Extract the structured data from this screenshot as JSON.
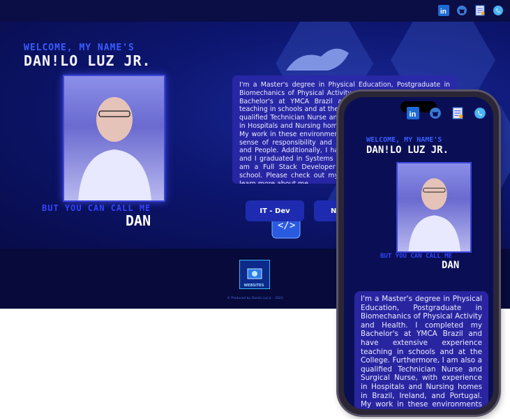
{
  "nav": {
    "icons": [
      "linkedin-icon",
      "github-icon",
      "resume-icon",
      "whatsapp-icon"
    ]
  },
  "hero": {
    "welcome": "WELCOME, MY NAME'S",
    "name": "DAN!LO LUZ JR.",
    "call_me": "BUT YOU CAN CALL ME",
    "nickname": "DAN",
    "bio": "I'm a Master's degree in Physical Education, Postgraduate in Biomechanics of Physical Activity and Health. I completed my Bachelor's at YMCA Brazil and have extensive experience teaching in schools and at the College. Furthermore, I am also a qualified Technician Nurse and Surgical Nurse, with experience in Hospitals and Nursing homes in Brazil, Ireland, and Portugal. My work in these environments has provided me with a strong sense of responsibility and sensitivity in dealing with Health and People. Additionally, I have advanced proficiency in Excel and I graduated in Systems Analysis at Anhanguera College. I am a Full Stack Developer from a renowned programming school. Please check out my projects below and feel free to learn more about me.",
    "buttons": [
      "IT - Dev",
      "Nu"
    ]
  },
  "footer": {
    "logo_text": "WEBSITES",
    "credit": "© Produced by Danilo Luz Jr. - 2023"
  },
  "phone": {
    "welcome": "WELCOME, MY NAME'S",
    "name": "DAN!LO LUZ JR.",
    "call_me": "BUT YOU CAN CALL ME",
    "nickname": "DAN",
    "bio": "I'm a Master's degree in Physical Education, Postgraduate in Biomechanics of Physical Activity and Health. I completed my Bachelor's at YMCA Brazil and have extensive experience teaching in schools and at the College. Furthermore, I am also a qualified Technician Nurse and Surgical Nurse, with experience in Hospitals and Nursing homes in Brazil, Ireland, and Portugal. My work in these environments has provided"
  },
  "colors": {
    "accent": "#3a5cff",
    "background": "#0a0b3a",
    "bio_panel": "#2c28aa"
  }
}
